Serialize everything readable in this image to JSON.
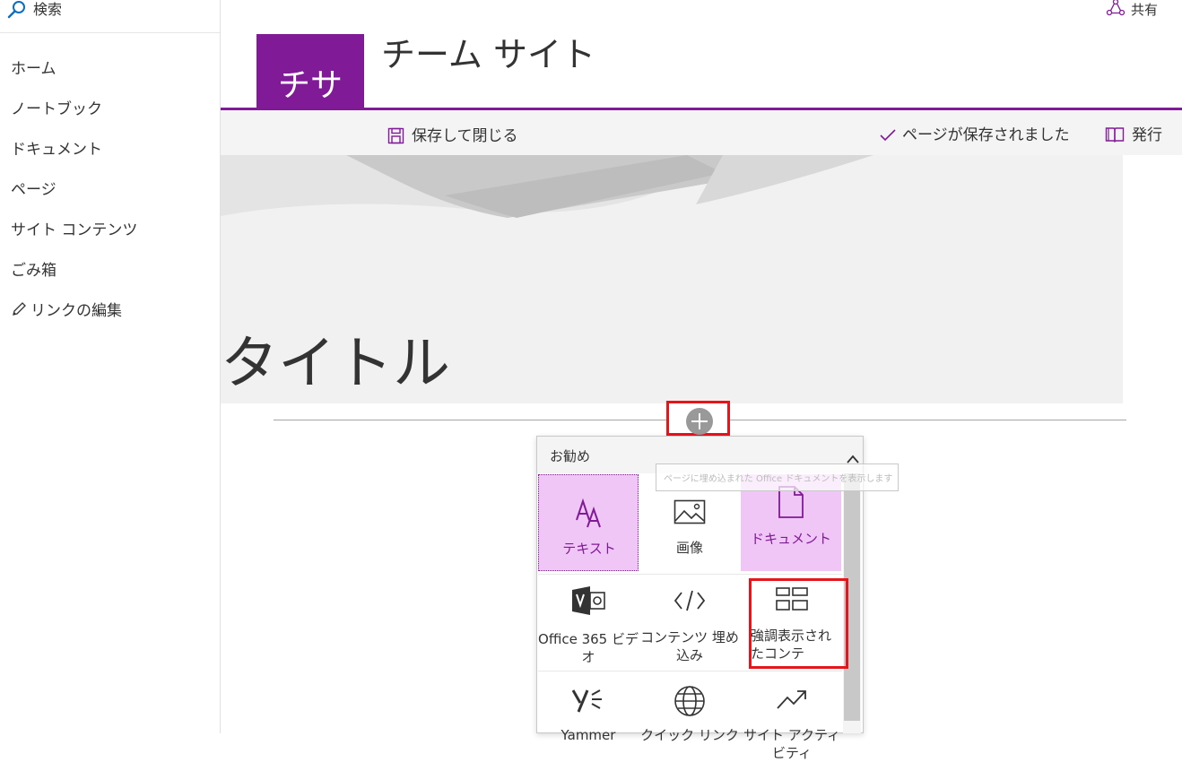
{
  "sidebar": {
    "search_label": "検索",
    "items": [
      {
        "label": "ホーム"
      },
      {
        "label": "ノートブック"
      },
      {
        "label": "ドキュメント"
      },
      {
        "label": "ページ"
      },
      {
        "label": "サイト コンテンツ"
      },
      {
        "label": "ごみ箱"
      },
      {
        "label": "リンクの編集"
      }
    ]
  },
  "header": {
    "share_label": "共有",
    "logo_text": "チサ",
    "site_title": "チーム サイト"
  },
  "command_bar": {
    "save_close_label": "保存して閉じる",
    "saved_status": "ページが保存されました",
    "publish_label": "発行"
  },
  "page": {
    "title": "タイトル"
  },
  "toolbox": {
    "header_label": "お勧め",
    "tooltip": "ページに埋め込まれた Office ドキュメントを表示します",
    "tiles": [
      {
        "label": "テキスト",
        "icon": "text-icon"
      },
      {
        "label": "画像",
        "icon": "image-icon"
      },
      {
        "label": "ドキュメント",
        "icon": "document-icon"
      },
      {
        "label": "Office 365 ビデオ",
        "icon": "video-icon"
      },
      {
        "label": "コンテンツ 埋め込み",
        "icon": "embed-icon"
      },
      {
        "label": "強調表示されたコンテ",
        "icon": "highlighted-content-icon"
      },
      {
        "label": "Yammer",
        "icon": "yammer-icon"
      },
      {
        "label": "クイック リンク",
        "icon": "globe-icon"
      },
      {
        "label": "サイト アクティビティ",
        "icon": "trend-icon"
      }
    ]
  },
  "colors": {
    "brand": "#801a97",
    "highlight_tile": "#f0c6f6",
    "annotation_red": "#e8141c",
    "command_bar_bg": "#f4f4f4"
  }
}
